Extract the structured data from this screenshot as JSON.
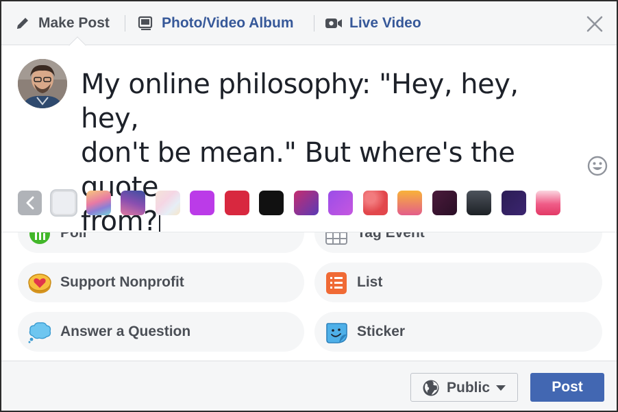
{
  "tabs": [
    {
      "label": "Make Post",
      "icon": "pencil-icon"
    },
    {
      "label": "Photo/Video Album",
      "icon": "photo-album-icon"
    },
    {
      "label": "Live Video",
      "icon": "video-camera-icon"
    }
  ],
  "composer": {
    "text_line1": "My online philosophy: \"Hey, hey, hey,",
    "text_line2": "don't be mean.\" But where's the quote",
    "text_line3": "from?"
  },
  "backgrounds": {
    "back_icon": "chevron-left-icon",
    "swatches": [
      {
        "name": "swatch-plain-white",
        "fill": "#eceef2"
      },
      {
        "name": "swatch-rainbow",
        "fill": "linear-gradient(160deg,#f6c87c,#e87aa4 45%,#8a7fd6 70%,#7bd3d9)"
      },
      {
        "name": "swatch-blue-purple-wave",
        "fill": "linear-gradient(200deg,#3b4fa0,#8a4fb0 50%,#e07aa0)"
      },
      {
        "name": "swatch-pastel-pattern",
        "fill": "linear-gradient(135deg,#f3e4d8,#f5d6e4 40%,#e6eef6 70%,#f7e6c8)"
      },
      {
        "name": "swatch-purple",
        "fill": "#bb3be8"
      },
      {
        "name": "swatch-red",
        "fill": "#d8283f"
      },
      {
        "name": "swatch-black",
        "fill": "#111111"
      },
      {
        "name": "swatch-magenta-blue",
        "fill": "linear-gradient(135deg,#c42d6f,#5a3ab6)"
      },
      {
        "name": "swatch-violet",
        "fill": "linear-gradient(135deg,#9b4de8,#c557e0)"
      },
      {
        "name": "swatch-hearts",
        "fill": "radial-gradient(circle at 30% 30%,#f27b7e 20%,#e2474c 60%)"
      },
      {
        "name": "swatch-sunset",
        "fill": "linear-gradient(180deg,#f8b23a,#e35d8a)"
      },
      {
        "name": "swatch-dark-plum",
        "fill": "linear-gradient(135deg,#4a1a3b,#2a0f26)"
      },
      {
        "name": "swatch-charcoal",
        "fill": "linear-gradient(180deg,#4d535c,#1d2126)"
      },
      {
        "name": "swatch-starry-night",
        "fill": "linear-gradient(135deg,#2c1d55,#3b2570)"
      },
      {
        "name": "swatch-pink-gradient",
        "fill": "linear-gradient(180deg,#fbd6e0,#ef5b87 55%,#e23a66)"
      }
    ]
  },
  "options": {
    "poll": {
      "label": "Poll",
      "icon": "poll-icon"
    },
    "tag_event": {
      "label": "Tag Event",
      "icon": "calendar-icon"
    },
    "support_nonprofit": {
      "label": "Support Nonprofit",
      "icon": "heart-coin-icon"
    },
    "list": {
      "label": "List",
      "icon": "list-icon"
    },
    "answer_question": {
      "label": "Answer a Question",
      "icon": "thought-bubble-icon"
    },
    "sticker": {
      "label": "Sticker",
      "icon": "sticker-icon"
    }
  },
  "footer": {
    "audience_label": "Public",
    "audience_icon": "globe-icon",
    "post_label": "Post"
  },
  "colors": {
    "accent_blue": "#4267b2",
    "link_blue": "#365899",
    "text_gray": "#4b4f56"
  }
}
